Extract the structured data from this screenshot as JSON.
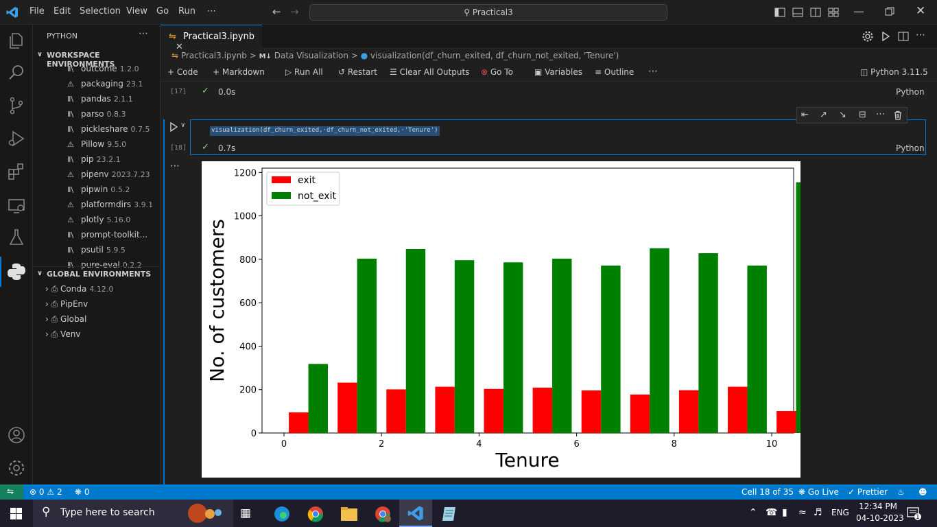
{
  "titlebar": {
    "menu": [
      "File",
      "Edit",
      "Selection",
      "View",
      "Go",
      "Run",
      "⋯"
    ],
    "search": "Practical3"
  },
  "sidebar": {
    "title": "PYTHON",
    "more": "⋯",
    "workspace_header": "WORKSPACE ENVIRONMENTS",
    "packages": [
      {
        "name": "outcome",
        "version": "1.2.0",
        "icon": "library-icon"
      },
      {
        "name": "packaging",
        "version": "23.1",
        "icon": "warning-icon"
      },
      {
        "name": "pandas",
        "version": "2.1.1",
        "icon": "library-icon"
      },
      {
        "name": "parso",
        "version": "0.8.3",
        "icon": "library-icon"
      },
      {
        "name": "pickleshare",
        "version": "0.7.5",
        "icon": "library-icon"
      },
      {
        "name": "Pillow",
        "version": "9.5.0",
        "icon": "warning-icon"
      },
      {
        "name": "pip",
        "version": "23.2.1",
        "icon": "library-icon"
      },
      {
        "name": "pipenv",
        "version": "2023.7.23",
        "icon": "warning-icon"
      },
      {
        "name": "pipwin",
        "version": "0.5.2",
        "icon": "library-icon"
      },
      {
        "name": "platformdirs",
        "version": "3.9.1",
        "icon": "warning-icon"
      },
      {
        "name": "plotly",
        "version": "5.16.0",
        "icon": "warning-icon"
      },
      {
        "name": "prompt-toolkit...",
        "version": "",
        "icon": "library-icon"
      },
      {
        "name": "psutil",
        "version": "5.9.5",
        "icon": "library-icon"
      },
      {
        "name": "pure-eval",
        "version": "0.2.2",
        "icon": "library-icon"
      }
    ],
    "global_header": "GLOBAL ENVIRONMENTS",
    "global_envs": [
      {
        "name": "Conda",
        "version": "4.12.0"
      },
      {
        "name": "PipEnv",
        "version": ""
      },
      {
        "name": "Global",
        "version": ""
      },
      {
        "name": "Venv",
        "version": ""
      }
    ]
  },
  "editor": {
    "tab_label": "Practical3.ipynb",
    "breadcrumb": {
      "file": "Practical3.ipynb",
      "section": "Data Visualization",
      "section_prefix": "M↓",
      "symbol": "visualization(df_churn_exited, df_churn_not_exited, 'Tenure')"
    },
    "toolbar": {
      "code": "Code",
      "markdown": "Markdown",
      "run_all": "Run All",
      "restart": "Restart",
      "clear": "Clear All Outputs",
      "goto": "Go To",
      "variables": "Variables",
      "outline": "Outline",
      "more": "⋯",
      "kernel": "Python 3.11.5"
    },
    "cell17": {
      "number": "[17]",
      "time": "0.0s",
      "lang": "Python"
    },
    "cell18": {
      "number": "[18]",
      "code": "visualization(df_churn_exited,·df_churn_not_exited,·'Tenure')",
      "time": "0.7s",
      "lang": "Python"
    },
    "output_more": "⋯"
  },
  "chart_data": {
    "type": "bar",
    "x": [
      0,
      1,
      2,
      3,
      4,
      5,
      6,
      7,
      8,
      9,
      10
    ],
    "series": [
      {
        "name": "exit",
        "color": "#ff0000",
        "values": [
          95,
          232,
          201,
          213,
          203,
          209,
          196,
          177,
          197,
          213,
          101
        ]
      },
      {
        "name": "not_exit",
        "color": "#008000",
        "values": [
          318,
          803,
          847,
          796,
          786,
          803,
          771,
          851,
          828,
          771,
          1155
        ]
      }
    ],
    "xlabel": "Tenure",
    "ylabel": "No. of customers",
    "xlim": [
      -0.45,
      10.45
    ],
    "ylim": [
      0,
      1220
    ],
    "xticks": [
      0,
      2,
      4,
      6,
      8,
      10
    ],
    "yticks": [
      0,
      200,
      400,
      600,
      800,
      1000,
      1200
    ],
    "legend": "top-left",
    "grid": false
  },
  "statusbar": {
    "errors": "0",
    "warnings": "2",
    "ports": "0",
    "cell": "Cell 18 of 35",
    "golive": "Go Live",
    "prettier": "Prettier"
  },
  "taskbar": {
    "search": "Type here to search",
    "lang": "ENG",
    "time": "12:34 PM",
    "date": "04-10-2023",
    "notif": "1"
  }
}
